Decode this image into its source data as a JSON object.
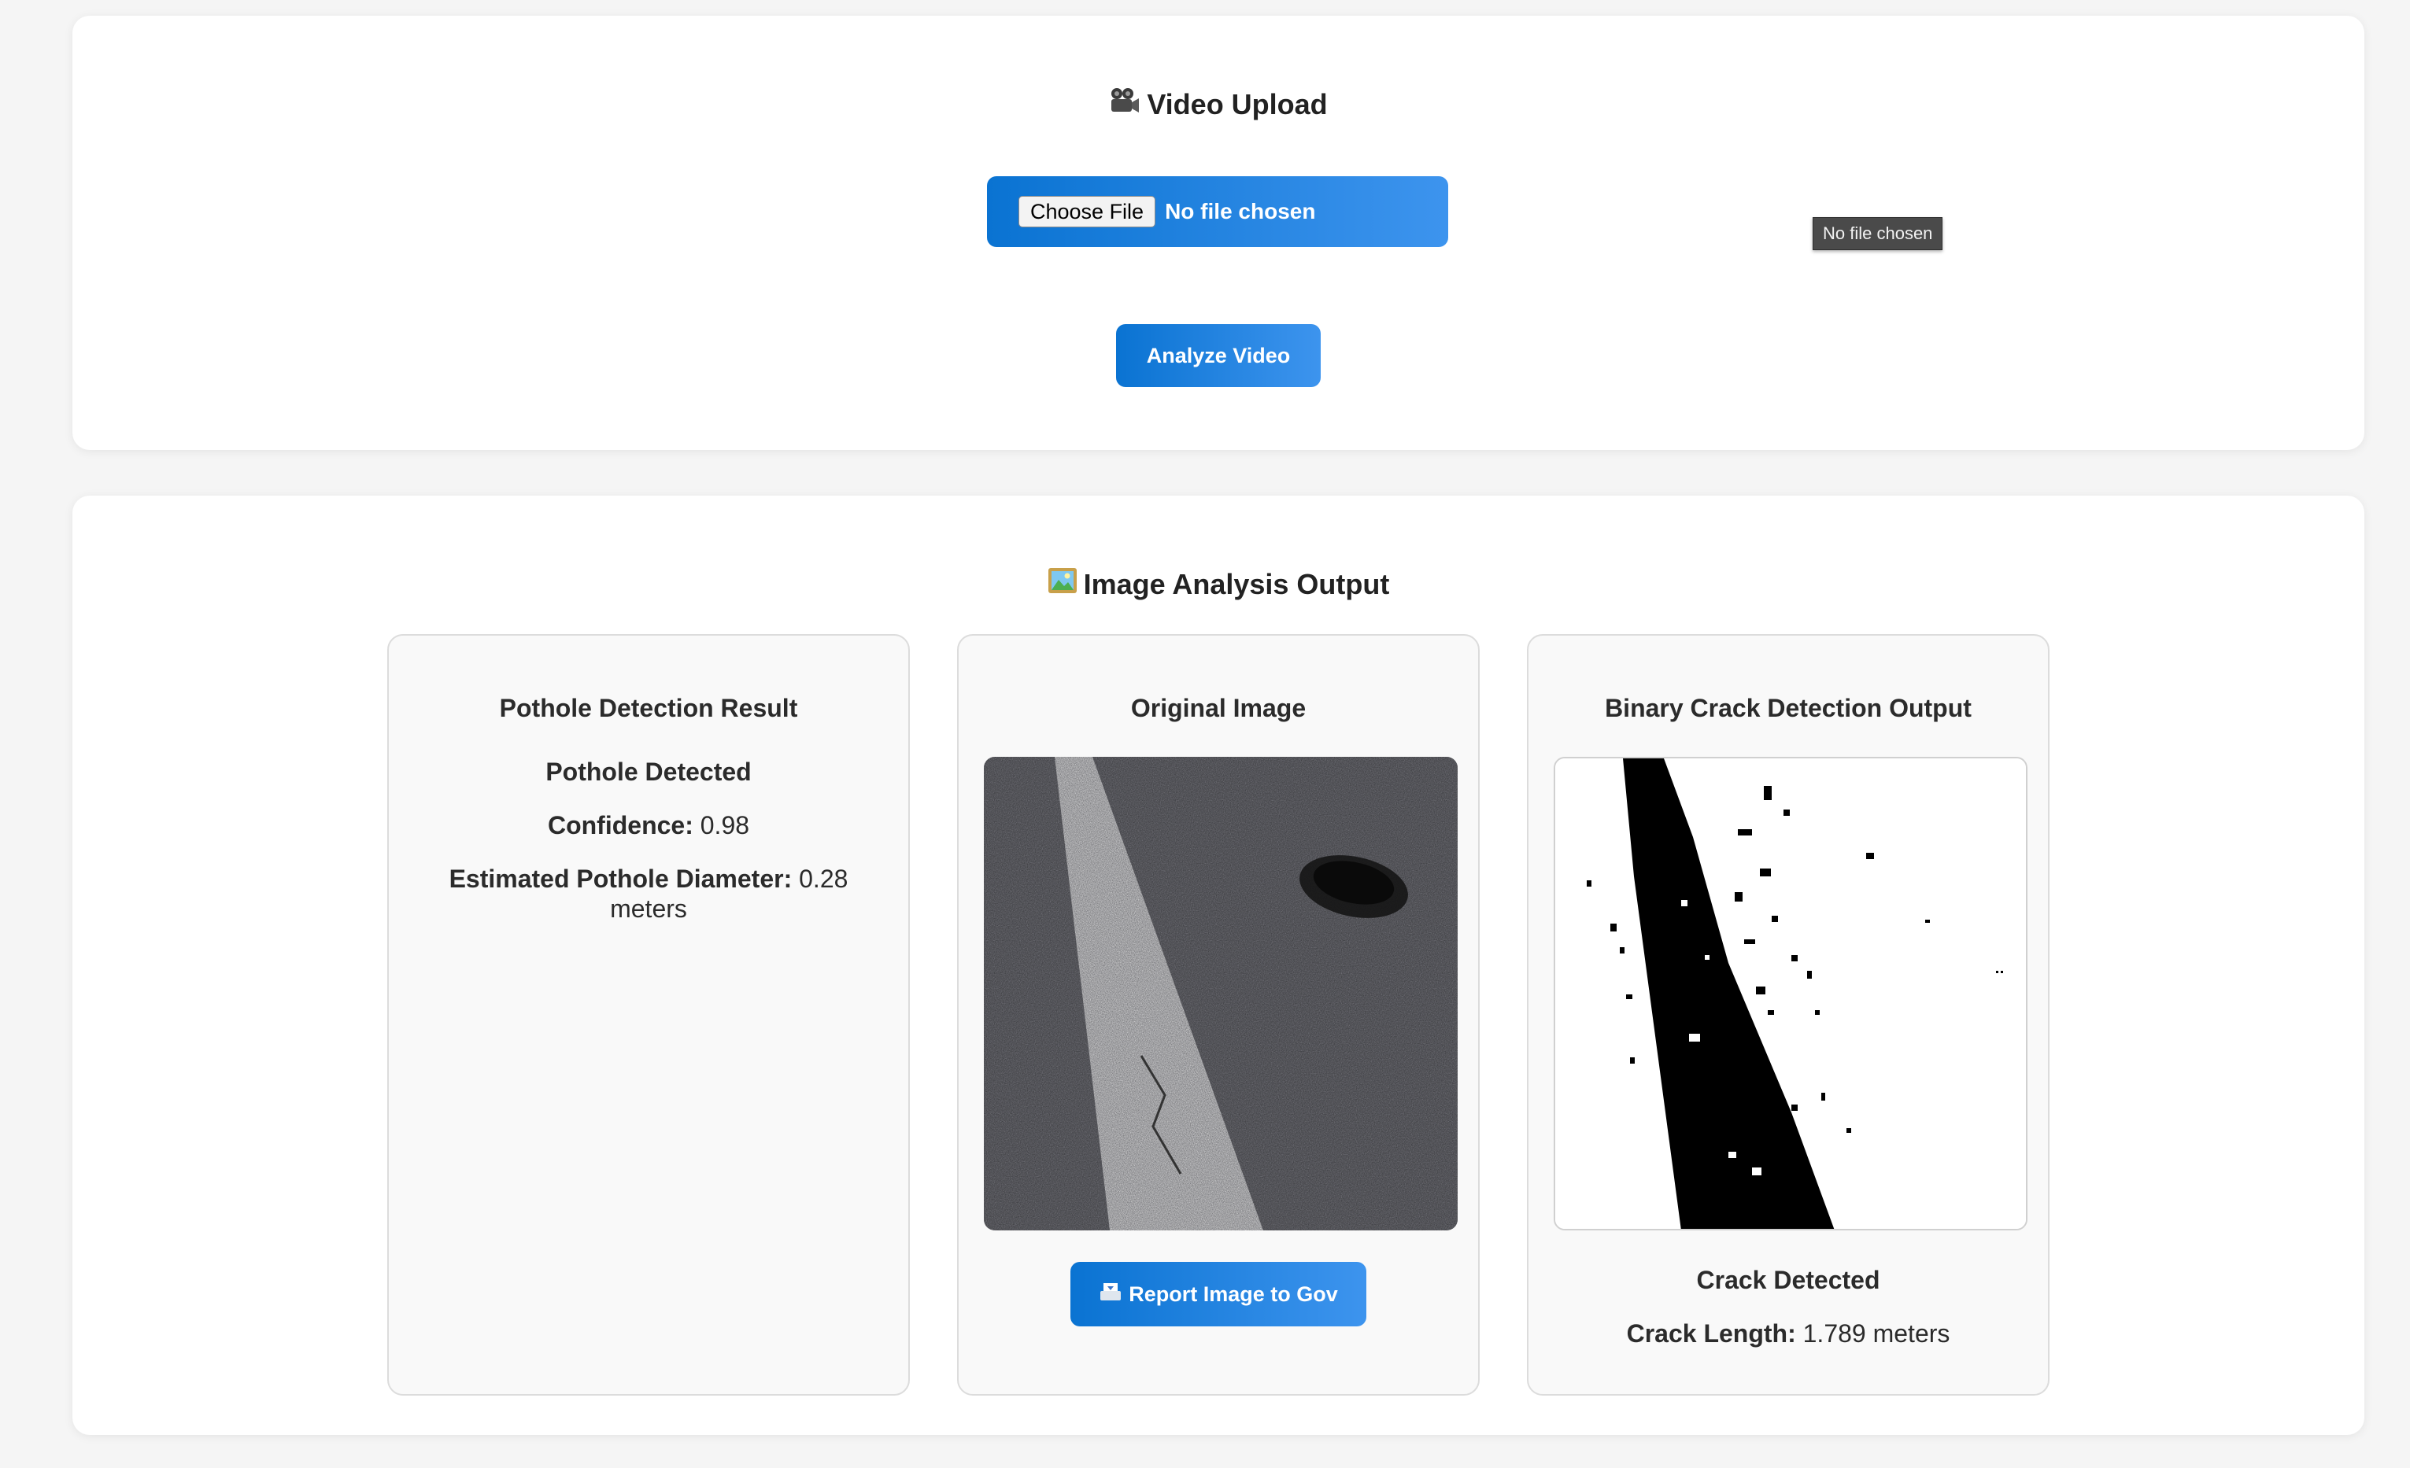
{
  "upload": {
    "title": "Video Upload",
    "title_icon": "video-camera-icon",
    "choose_button": "Choose File",
    "file_status": "No file chosen",
    "tooltip": "No file chosen",
    "analyze_button": "Analyze Video"
  },
  "output": {
    "title": "Image Analysis Output",
    "title_icon": "framed-picture-icon",
    "pothole": {
      "title": "Pothole Detection Result",
      "status": "Pothole Detected",
      "confidence_label": "Confidence:",
      "confidence_value": "0.98",
      "diameter_label": "Estimated Pothole Diameter:",
      "diameter_value": "0.28",
      "diameter_unit": "meters"
    },
    "original": {
      "title": "Original Image",
      "report_button": "Report Image to Gov",
      "report_icon": "inbox-tray-icon"
    },
    "binary": {
      "title": "Binary Crack Detection Output",
      "status": "Crack Detected",
      "length_label": "Crack Length:",
      "length_value": "1.789 meters"
    }
  },
  "colors": {
    "accent_start": "#0a73d2",
    "accent_end": "#3d94ee",
    "page_bg": "#f5f5f5",
    "card_bg": "#ffffff",
    "panel_bg": "#f9f9f9"
  }
}
